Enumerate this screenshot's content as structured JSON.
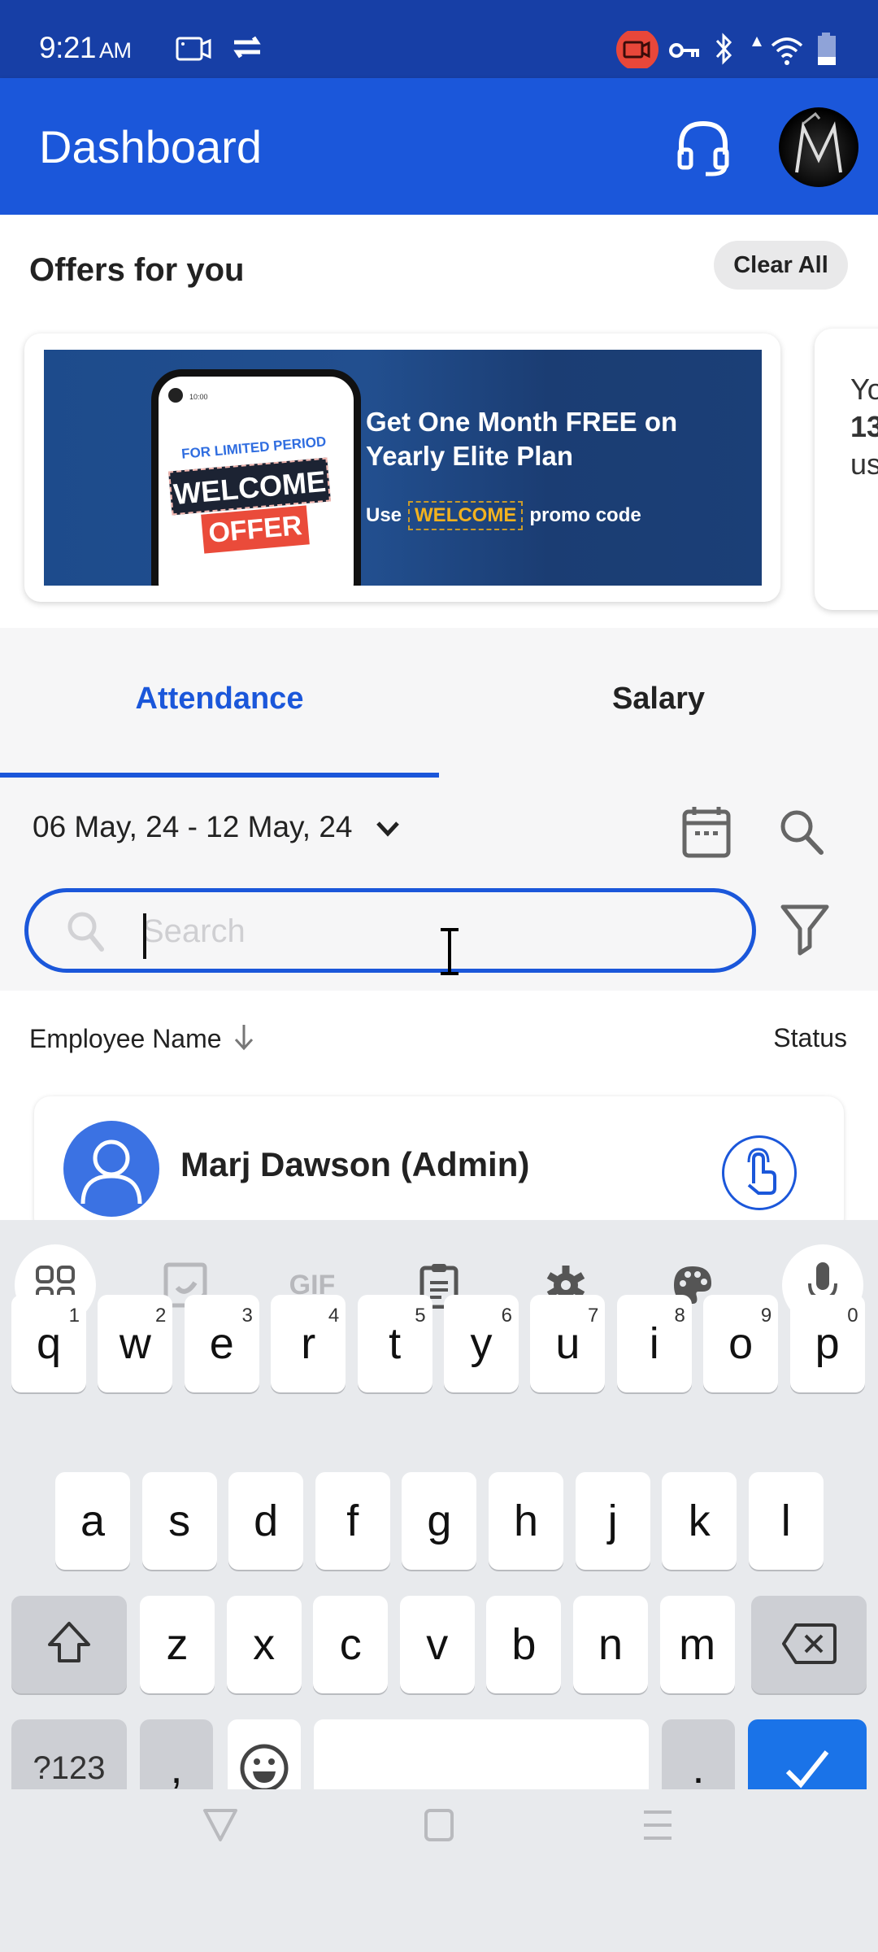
{
  "status_bar": {
    "time": "9:21",
    "ampm": "AM",
    "icons": [
      "screen-record-icon",
      "sync-icon",
      "video-camera-icon",
      "vpn-key-icon",
      "bluetooth-icon",
      "data-arrow-icon",
      "wifi-icon",
      "battery-icon"
    ]
  },
  "app_bar": {
    "title": "Dashboard",
    "icons": [
      "headset-icon",
      "profile-avatar"
    ]
  },
  "offers": {
    "title": "Offers for you",
    "clear_all_label": "Clear All",
    "banner": {
      "phone_time": "10:00",
      "limited_text": "FOR LIMITED PERIOD",
      "welcome_text": "WELCOME",
      "offer_text": "OFFER",
      "headline": "Get One Month FREE on Yearly Elite Plan",
      "promo_prefix": "Use",
      "promo_code": "WELCOME",
      "promo_suffix": "promo code"
    },
    "next_card": {
      "line1": "Yo",
      "line2": "13",
      "line3": "us"
    }
  },
  "tabs": [
    {
      "label": "Attendance",
      "active": true
    },
    {
      "label": "Salary",
      "active": false
    }
  ],
  "filters": {
    "date_range": "06 May, 24 - 12 May, 24",
    "search_placeholder": "Search",
    "search_value": ""
  },
  "list": {
    "columns": {
      "name": "Employee Name",
      "status": "Status"
    },
    "rows": [
      {
        "name": "Marj Dawson (Admin)"
      }
    ]
  },
  "keyboard": {
    "toolbar": [
      "apps-grid-icon",
      "sticker-icon",
      "gif-icon",
      "clipboard-icon",
      "settings-gear-icon",
      "palette-icon",
      "microphone-icon"
    ],
    "gif_label": "GIF",
    "row1": [
      {
        "k": "q",
        "n": "1"
      },
      {
        "k": "w",
        "n": "2"
      },
      {
        "k": "e",
        "n": "3"
      },
      {
        "k": "r",
        "n": "4"
      },
      {
        "k": "t",
        "n": "5"
      },
      {
        "k": "y",
        "n": "6"
      },
      {
        "k": "u",
        "n": "7"
      },
      {
        "k": "i",
        "n": "8"
      },
      {
        "k": "o",
        "n": "9"
      },
      {
        "k": "p",
        "n": "0"
      }
    ],
    "row2": [
      "a",
      "s",
      "d",
      "f",
      "g",
      "h",
      "j",
      "k",
      "l"
    ],
    "row3": [
      "z",
      "x",
      "c",
      "v",
      "b",
      "n",
      "m"
    ],
    "symbols_label": "?123",
    "comma_label": ",",
    "period_label": "."
  },
  "colors": {
    "primary": "#1b57da",
    "status_bar": "#173fa6",
    "keyboard_bg": "#e8eaed",
    "enter_key": "#1a73e8"
  }
}
